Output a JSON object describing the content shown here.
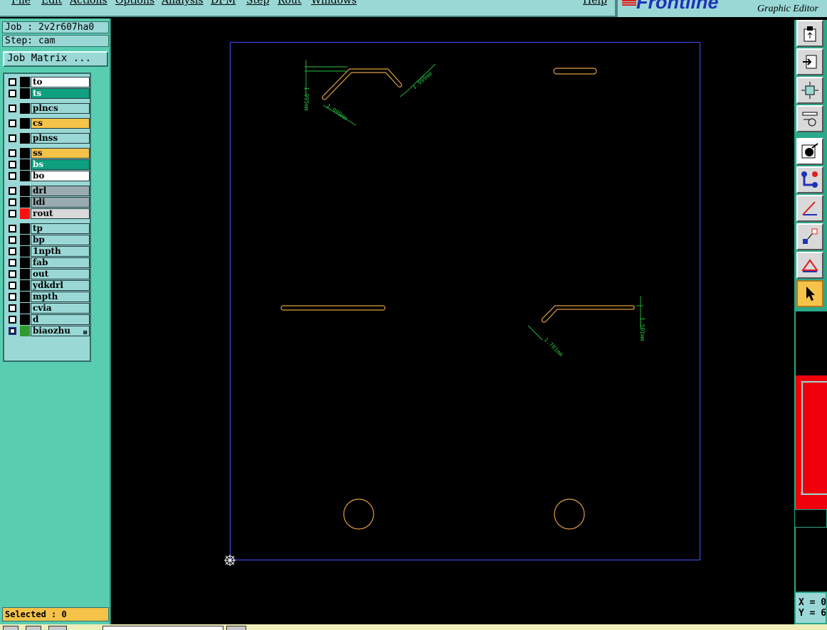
{
  "menu": {
    "file": "File",
    "edit": "Edit",
    "actions": "Actions",
    "options": "Options",
    "analysis": "Analysis",
    "dfm": "DFM",
    "step": "Step",
    "rout": "Rout",
    "windows": "Windows",
    "help": "Help"
  },
  "brand": {
    "logo": "Frontline",
    "subtitle": "Graphic Editor"
  },
  "job": {
    "job_line": "Job : 2v2r607ha0",
    "step_line": "Step: cam",
    "matrix_button": "Job Matrix ..."
  },
  "layers": [
    {
      "name": "to",
      "color": "#ffffff"
    },
    {
      "name": "ts",
      "color": "#0ea07f"
    },
    {
      "name": "plncs",
      "color": "#9ad8d6"
    },
    {
      "name": "cs",
      "color": "#f5c34a"
    },
    {
      "name": "plnss",
      "color": "#9ad8d6"
    },
    {
      "name": "ss",
      "color": "#f5c34a"
    },
    {
      "name": "bs",
      "color": "#0ea07f"
    },
    {
      "name": "bo",
      "color": "#ffffff"
    },
    {
      "name": "drl",
      "color": "#9aabb0"
    },
    {
      "name": "ldi",
      "color": "#9aabb0"
    },
    {
      "name": "rout",
      "color": "#d9d9d9",
      "swatch": "#ff1010"
    },
    {
      "name": "tp",
      "color": "#9ad8d6"
    },
    {
      "name": "bp",
      "color": "#9ad8d6"
    },
    {
      "name": "1npth",
      "color": "#9ad8d6"
    },
    {
      "name": "fab",
      "color": "#9ad8d6"
    },
    {
      "name": "out",
      "color": "#9ad8d6"
    },
    {
      "name": "ydkdrl",
      "color": "#9ad8d6"
    },
    {
      "name": "mpth",
      "color": "#9ad8d6"
    },
    {
      "name": "cvia",
      "color": "#9ad8d6"
    },
    {
      "name": "d",
      "color": "#9ad8d6"
    },
    {
      "name": "biaozhu",
      "color": "#9ad8d6",
      "swatch": "#2f9a2f",
      "selected": true
    }
  ],
  "status": {
    "selected": "Selected : 0"
  },
  "canvas": {
    "dimensions": {
      "dim1": "1.999mm",
      "dim2": "1.995mm",
      "dim3": "1.999mm",
      "dim4": "1.501mm",
      "dim5": "1.781mm"
    },
    "colors": {
      "profile": "#3c46e0",
      "feature": "#e0a040",
      "dimension": "#22c040"
    }
  },
  "coords": {
    "x": "X = 0",
    "y": "Y = 6"
  },
  "tools": [
    "paste-icon",
    "move-to-icon",
    "fit-screen-icon",
    "measure-icon",
    "snap-icon",
    "connect-icon",
    "angle-measure-icon",
    "select-mode-icon",
    "triangle-icon",
    "pointer-icon"
  ]
}
